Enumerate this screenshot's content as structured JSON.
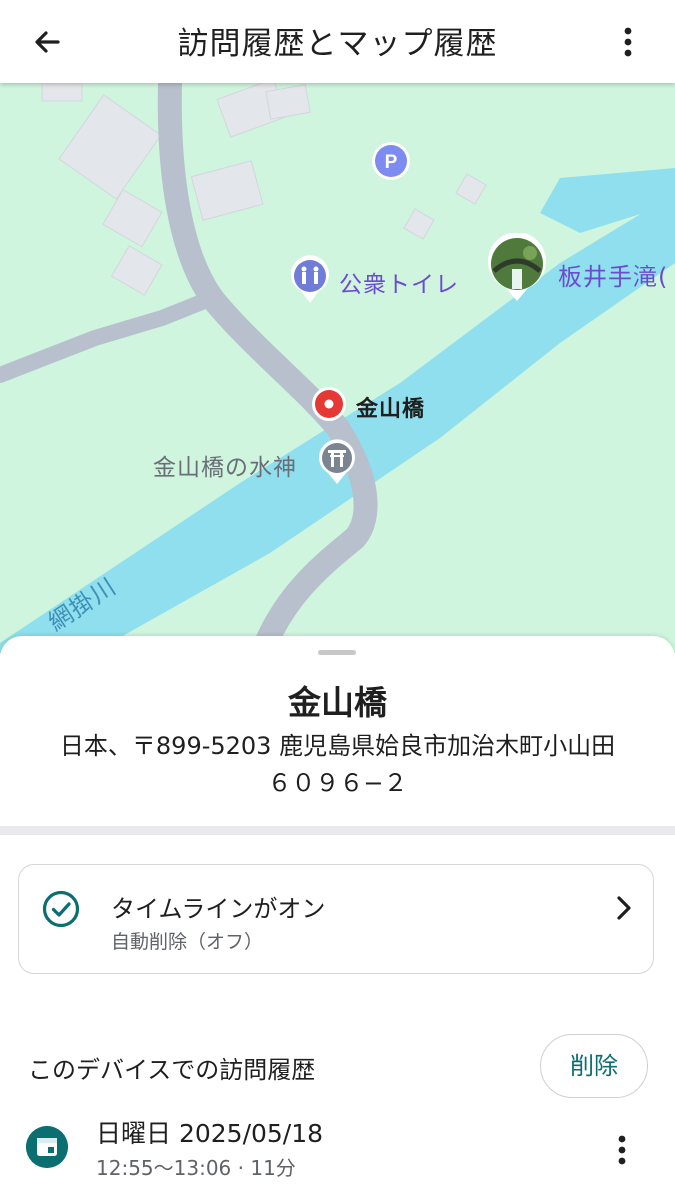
{
  "header": {
    "title": "訪問履歴とマップ履歴",
    "back_icon": "arrow-back-icon",
    "menu_icon": "more-vert-icon"
  },
  "map": {
    "colors": {
      "land": "#cff5de",
      "water": "#8fdfee",
      "road": "#b7c0cc",
      "building": "#e3e6ea",
      "poi_text": "#6d4bd1",
      "selected_pin": "#e53935"
    },
    "labels": {
      "parking": "P",
      "toilet": "公衆トイレ",
      "waterfall": "板井手滝(",
      "selected": "金山橋",
      "shrine": "金山橋の水神",
      "river": "網掛川"
    }
  },
  "place": {
    "name": "金山橋",
    "address_line1": "日本、〒899-5203 鹿児島県姶良市加治木町小山田",
    "address_line2": "６０９６−２"
  },
  "timeline_card": {
    "title": "タイムラインがオン",
    "subtitle": "自動削除（オフ）",
    "icon": "check-circle-icon"
  },
  "history": {
    "section_title": "このデバイスでの訪問履歴",
    "delete_label": "削除",
    "visit": {
      "date": "日曜日 2025/05/18",
      "time": "12:55〜13:06 · 11分",
      "icon": "calendar-icon"
    }
  }
}
